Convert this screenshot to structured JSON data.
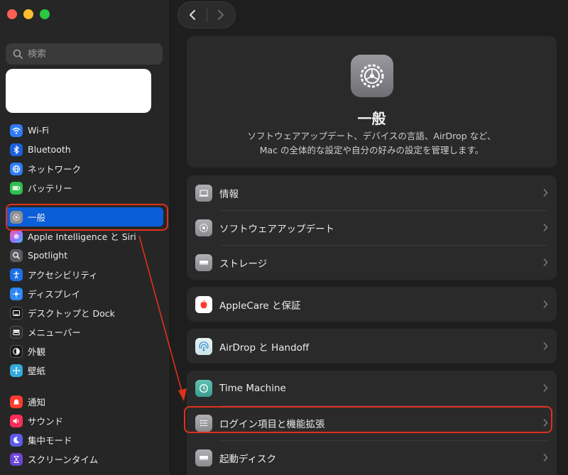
{
  "window": {
    "traffic_lights": [
      "close",
      "minimize",
      "zoom"
    ]
  },
  "sidebar": {
    "search_placeholder": "検索",
    "group1": [
      {
        "label": "Wi-Fi",
        "icon": "wifi-icon"
      },
      {
        "label": "Bluetooth",
        "icon": "bluetooth-icon"
      },
      {
        "label": "ネットワーク",
        "icon": "globe-icon"
      },
      {
        "label": "バッテリー",
        "icon": "battery-icon"
      }
    ],
    "group2": [
      {
        "label": "一般",
        "icon": "gear-icon",
        "selected": true
      },
      {
        "label": "Apple Intelligence と Siri",
        "icon": "siri-icon"
      },
      {
        "label": "Spotlight",
        "icon": "magnifier-icon"
      },
      {
        "label": "アクセシビリティ",
        "icon": "accessibility-icon"
      },
      {
        "label": "ディスプレイ",
        "icon": "sun-icon"
      },
      {
        "label": "デスクトップと Dock",
        "icon": "dock-icon"
      },
      {
        "label": "メニューバー",
        "icon": "menubar-icon"
      },
      {
        "label": "外観",
        "icon": "appearance-icon"
      },
      {
        "label": "壁紙",
        "icon": "wallpaper-icon"
      }
    ],
    "group3": [
      {
        "label": "通知",
        "icon": "bell-icon"
      },
      {
        "label": "サウンド",
        "icon": "speaker-icon"
      },
      {
        "label": "集中モード",
        "icon": "moon-icon"
      },
      {
        "label": "スクリーンタイム",
        "icon": "hourglass-icon"
      }
    ]
  },
  "main": {
    "title": "一般",
    "description_line1": "ソフトウェアアップデート、デバイスの言語、AirDrop など、",
    "description_line2": "Mac の全体的な設定や自分の好みの設定を管理します。",
    "cards": [
      [
        {
          "label": "情報",
          "icon": "laptop-icon"
        },
        {
          "label": "ソフトウェアアップデート",
          "icon": "update-gear-icon"
        },
        {
          "label": "ストレージ",
          "icon": "drive-icon"
        }
      ],
      [
        {
          "label": "AppleCare と保証",
          "icon": "apple-icon"
        }
      ],
      [
        {
          "label": "AirDrop と Handoff",
          "icon": "airdrop-icon"
        }
      ],
      [
        {
          "label": "Time Machine",
          "icon": "time-machine-icon"
        },
        {
          "label": "ログイン項目と機能拡張",
          "icon": "list-icon"
        },
        {
          "label": "起動ディスク",
          "icon": "startup-disk-icon"
        }
      ]
    ]
  },
  "colors": {
    "accent": "#0a5fd8",
    "annotation": "#e0301e"
  }
}
